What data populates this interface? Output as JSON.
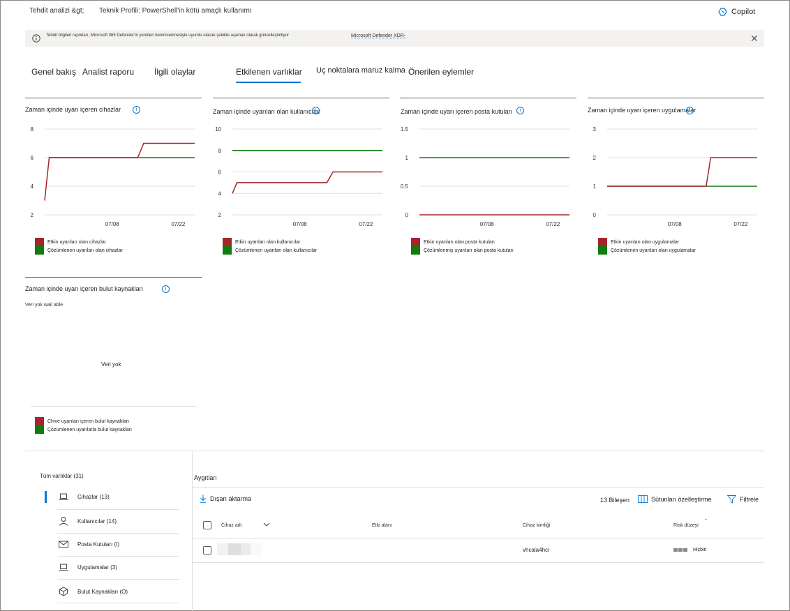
{
  "breadcrumb": {
    "items": [
      "Tehdit analizi &gt;",
      "Teknik Profili: PowerShell'in kötü amaçlı kullanımı"
    ]
  },
  "copilot": {
    "label": "Copilot",
    "icon": "copilot-icon"
  },
  "banner": {
    "text": "Tehdit bilgileri raporları, Microsoft 365 Defender'in yeniden benimsenmesiyle uyumlu olacak şekilde aşamalı olarak güncelleştiriliyor",
    "link": "Microsoft Defender XDR-"
  },
  "tabs": [
    {
      "label": "Genel bakış",
      "active": false
    },
    {
      "label": "Analist raporu",
      "active": false
    },
    {
      "label": "İlgili olaylar",
      "active": false
    },
    {
      "label": "Etkilenen varlıklar",
      "active": true
    },
    {
      "label": "Uç noktalara maruz kalma",
      "active": false
    },
    {
      "label": "Önerilen eylemler",
      "active": false
    }
  ],
  "colors": {
    "active_series": "#a4262c",
    "resolved_series": "#107c10",
    "accent": "#0078d4"
  },
  "chart_data": [
    {
      "type": "line",
      "title": "Zaman içinde uyarı içeren cihazlar",
      "x_ticks": [
        "07/08",
        "07/22"
      ],
      "y_ticks": [
        "8",
        "6",
        "4",
        "2"
      ],
      "ylim": [
        2,
        8
      ],
      "series": [
        {
          "name": "Etkin uyarıları olan cihazlar",
          "color": "#a4262c",
          "values": [
            [
              0,
              3
            ],
            [
              0.03,
              6
            ],
            [
              0.62,
              6
            ],
            [
              0.66,
              7
            ],
            [
              1,
              7
            ]
          ]
        },
        {
          "name": "Çözümlenen uyarıları olan cihazlar",
          "color": "#107c10",
          "values": [
            [
              0.03,
              6
            ],
            [
              1,
              6
            ]
          ]
        }
      ]
    },
    {
      "type": "line",
      "title": "Zaman içinde uyarıları olan kullanıcılar",
      "x_ticks": [
        "07/08",
        "07/22"
      ],
      "y_ticks": [
        "10",
        "8",
        "6",
        "4",
        "2"
      ],
      "ylim": [
        2,
        10
      ],
      "series": [
        {
          "name": "Etkin uyarıları olan kullanıcılar",
          "color": "#a4262c",
          "values": [
            [
              0,
              4
            ],
            [
              0.03,
              5
            ],
            [
              0.63,
              5
            ],
            [
              0.67,
              6
            ],
            [
              1,
              6
            ]
          ]
        },
        {
          "name": "Çözümlenen uyarıları olan kullanıcılar",
          "color": "#107c10",
          "values": [
            [
              0,
              8
            ],
            [
              1,
              8
            ]
          ]
        }
      ]
    },
    {
      "type": "line",
      "title": "Zaman içinde uyarı içeren posta kutuları",
      "x_ticks": [
        "07/08",
        "07/22"
      ],
      "y_ticks": [
        "1.5",
        "1",
        "0.5",
        "0"
      ],
      "ylim": [
        0,
        1.5
      ],
      "series": [
        {
          "name": "Etkin uyarıları olan posta kutuları",
          "color": "#a4262c",
          "values": [
            [
              0,
              0
            ],
            [
              1,
              0
            ]
          ]
        },
        {
          "name": "Çözümlenmiş uyarıları olan posta kutuları",
          "color": "#107c10",
          "values": [
            [
              0,
              1
            ],
            [
              1,
              1
            ]
          ]
        }
      ]
    },
    {
      "type": "line",
      "title": "Zaman içinde uyarı içeren uygulamalar",
      "x_ticks": [
        "07/08",
        "07/22"
      ],
      "y_ticks": [
        "3",
        "2",
        "1",
        "0"
      ],
      "ylim": [
        0,
        3
      ],
      "series": [
        {
          "name": "Etkin uyarıları olan uygulamalar",
          "color": "#a4262c",
          "values": [
            [
              0,
              1
            ],
            [
              0.66,
              1
            ],
            [
              0.69,
              2
            ],
            [
              1,
              2
            ]
          ]
        },
        {
          "name": "Çözümlenen uyarıları olan uygulamalar",
          "color": "#107c10",
          "values": [
            [
              0,
              1
            ],
            [
              1,
              1
            ]
          ]
        }
      ]
    },
    {
      "type": "line",
      "title": "Zaman içinde uyarı içeren bulut kaynakları",
      "subtitle": "Veri yok wail able",
      "empty_text": "Veri yok",
      "series": [
        {
          "name": "Chive uyarıları içeren bulut kaynakları",
          "color": "#a4262c",
          "values": []
        },
        {
          "name": "Çözümlenen uyarılarla bulut kaynakları",
          "color": "#107c10",
          "values": []
        }
      ]
    }
  ],
  "assets": {
    "all_label": "Tüm varlıklar (31)",
    "items": [
      {
        "label": "Cihazlar (13)",
        "icon": "laptop-icon",
        "selected": true
      },
      {
        "label": "Kullanıcılar (14)",
        "icon": "person-icon",
        "selected": false
      },
      {
        "label": "Posta Kutuları (I)",
        "icon": "mail-icon",
        "selected": false
      },
      {
        "label": "Uygulamalar (3)",
        "icon": "laptop-icon",
        "selected": false
      },
      {
        "label": "Bulut Kaynakları (O)",
        "icon": "cube-icon",
        "selected": false
      }
    ]
  },
  "devices": {
    "title": "Aygıtları",
    "export_label": "Dışarı aktarma",
    "count_label": "13 Bileşen",
    "customize_label": "Sütunları özelleştirme",
    "filter_label": "Filtrele",
    "columns": [
      "Cihaz adı",
      "Etki alanı",
      "Cihaz kimliği",
      "Risk düzeyi"
    ],
    "rows": [
      {
        "name": "",
        "domain": "",
        "device_id": "vhcala4hci",
        "risk": "Hiçbiri"
      }
    ]
  }
}
